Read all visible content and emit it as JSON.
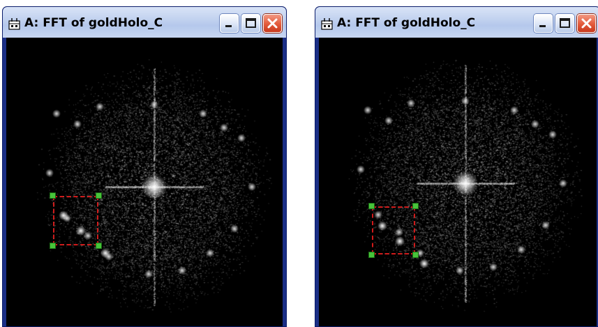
{
  "windows": [
    {
      "title": "A: FFT of goldHolo_C",
      "icon": "image-window-icon",
      "controls": [
        "minimize-icon",
        "maximize-icon",
        "close-icon"
      ]
    },
    {
      "title": "A: FFT of goldHolo_C",
      "icon": "image-window-icon",
      "controls": [
        "minimize-icon",
        "maximize-icon",
        "close-icon"
      ]
    }
  ],
  "colors": {
    "title_bar": "#c2d2ef",
    "frame": "#1b2f86",
    "image_background": "#000000",
    "roi_dash_a": "#ffffff",
    "roi_dash_b": "#d11a1a",
    "roi_handle": "#47c43a",
    "close_button": "#e35a3b"
  }
}
